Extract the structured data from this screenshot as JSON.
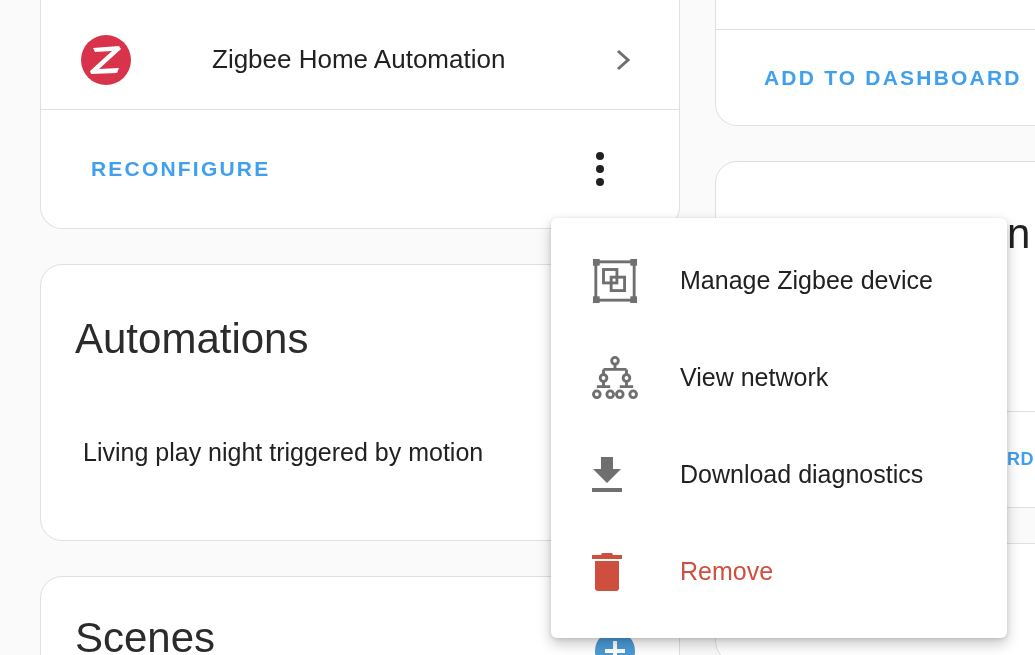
{
  "integration_card": {
    "integration": "Zigbee Home Automation",
    "action": "RECONFIGURE"
  },
  "automations_card": {
    "title": "Automations",
    "items": [
      "Living play night triggered by motion"
    ]
  },
  "scenes_card": {
    "title": "Scenes"
  },
  "right_cards": [
    {
      "action": "ADD TO DASHBOARD"
    },
    {
      "title": "n",
      "action": "RD"
    }
  ],
  "menu": {
    "items": [
      {
        "kind": "manage",
        "label": "Manage Zigbee device"
      },
      {
        "kind": "network",
        "label": "View network"
      },
      {
        "kind": "download",
        "label": "Download diagnostics"
      },
      {
        "kind": "remove",
        "label": "Remove"
      }
    ]
  }
}
